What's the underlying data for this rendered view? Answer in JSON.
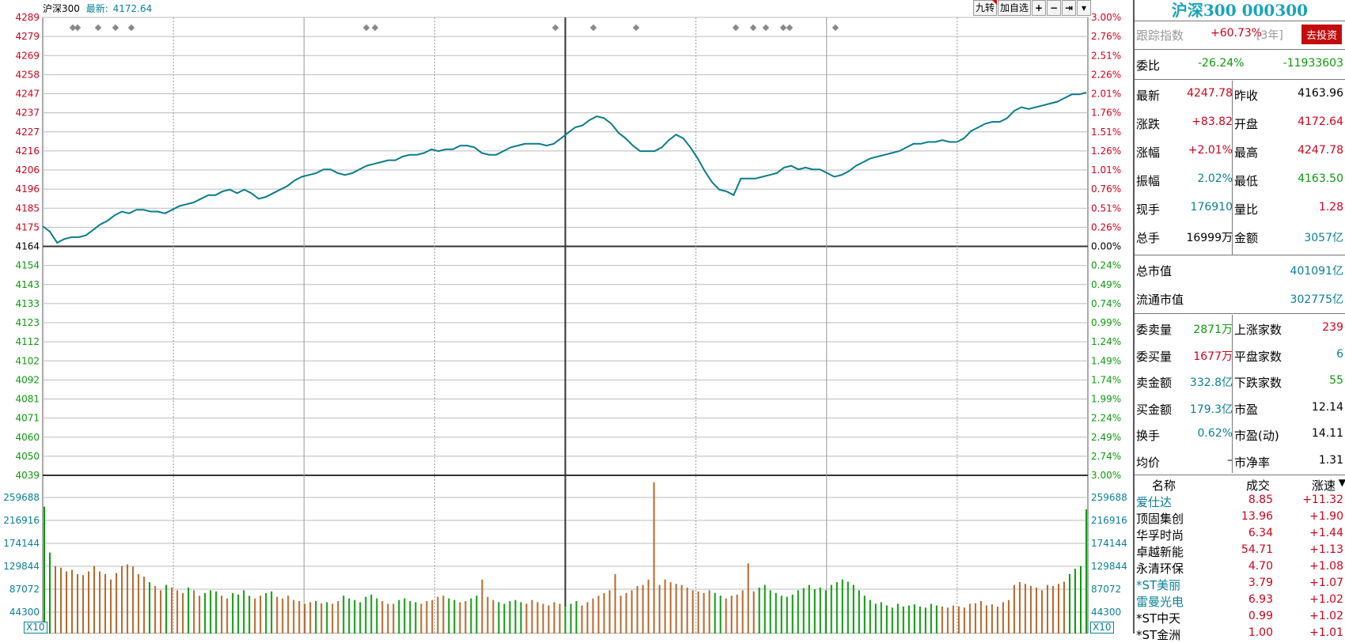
{
  "top_info": {
    "name": "沪深300",
    "latest_label": "最新:",
    "latest_value": "4172.64"
  },
  "toolbar": {
    "jiuzhuan": "九转",
    "add_fav": "加自选",
    "plus": "+",
    "minus": "−",
    "end": "⇥",
    "dropdown": "▾"
  },
  "price_axis": {
    "left": [
      "4289",
      "4279",
      "4269",
      "4258",
      "4247",
      "4237",
      "4227",
      "4216",
      "4206",
      "4196",
      "4185",
      "4175",
      "4164",
      "4154",
      "4143",
      "4133",
      "4123",
      "4112",
      "4102",
      "4092",
      "4081",
      "4071",
      "4060",
      "4050",
      "4039"
    ],
    "right": [
      "3.00%",
      "2.76%",
      "2.51%",
      "2.26%",
      "2.01%",
      "1.76%",
      "1.51%",
      "1.26%",
      "1.01%",
      "0.76%",
      "0.51%",
      "0.26%",
      "0.00%",
      "0.24%",
      "0.49%",
      "0.74%",
      "0.99%",
      "1.24%",
      "1.49%",
      "1.74%",
      "1.99%",
      "2.24%",
      "2.49%",
      "2.74%",
      "3.00%"
    ]
  },
  "volume_axis": {
    "labels": [
      "259688",
      "216916",
      "174144",
      "129844",
      "87072",
      "44300"
    ],
    "multiplier": "X10"
  },
  "chart_data": {
    "type": "line",
    "prev_close": 4163.96,
    "ylim": [
      4039,
      4289
    ],
    "price": [
      4175,
      4172,
      4166,
      4168,
      4169,
      4169,
      4170,
      4173,
      4176,
      4178,
      4181,
      4183,
      4182,
      4184,
      4184,
      4183,
      4183,
      4182,
      4184,
      4186,
      4187,
      4188,
      4190,
      4192,
      4192,
      4194,
      4195,
      4193,
      4195,
      4193,
      4190,
      4191,
      4193,
      4195,
      4197,
      4200,
      4202,
      4203,
      4204,
      4206,
      4206,
      4204,
      4203,
      4204,
      4206,
      4208,
      4209,
      4210,
      4211,
      4211,
      4213,
      4214,
      4214,
      4215,
      4217,
      4216,
      4217,
      4217,
      4219,
      4219,
      4218,
      4215,
      4214,
      4214,
      4216,
      4218,
      4219,
      4220,
      4220,
      4220,
      4219,
      4220,
      4223,
      4226,
      4229,
      4230,
      4233,
      4235,
      4234,
      4231,
      4226,
      4223,
      4219,
      4216,
      4216,
      4216,
      4218,
      4222,
      4225,
      4223,
      4218,
      4212,
      4205,
      4199,
      4195,
      4194,
      4192,
      4201,
      4201,
      4201,
      4202,
      4203,
      4204,
      4207,
      4208,
      4206,
      4207,
      4206,
      4206,
      4204,
      4202,
      4203,
      4205,
      4208,
      4210,
      4212,
      4213,
      4214,
      4215,
      4216,
      4218,
      4220,
      4220,
      4221,
      4221,
      4222,
      4221,
      4221,
      4223,
      4227,
      4229,
      4231,
      4232,
      4232,
      4234,
      4238,
      4240,
      4239,
      4240,
      4241,
      4242,
      4243,
      4245,
      4247,
      4247,
      4248
    ],
    "volume_markers": [
      235000,
      150000,
      125000,
      122000,
      115000,
      118000,
      110000,
      108000,
      115000,
      125000,
      115000,
      110000,
      100000,
      112000,
      125000,
      128000,
      124000,
      110000,
      105000,
      95000,
      88000,
      80000,
      90000,
      85000,
      80000,
      75000,
      85000,
      80000,
      70000,
      75000,
      80000,
      78000,
      70000,
      65000,
      75000,
      72000,
      80000,
      70000,
      65000,
      70000,
      75000,
      78000,
      68000,
      65000,
      70000,
      62000,
      60000,
      55000,
      58000,
      60000,
      56000,
      58000,
      55000,
      60000,
      70000,
      65000,
      62000,
      58000,
      68000,
      72000,
      65000,
      60000,
      55000,
      55000,
      62000,
      65000,
      60000,
      58000,
      55000,
      60000,
      62000,
      68000,
      70000,
      65000,
      62000,
      58000,
      60000,
      65000,
      70000,
      100000,
      68000,
      62000,
      58000,
      55000,
      60000,
      62000,
      58000,
      55000,
      62000,
      58000,
      55000,
      52000,
      58000,
      55000,
      50000,
      55000,
      60000,
      52000,
      58000,
      65000,
      70000,
      75000,
      80000,
      110000,
      70000,
      75000,
      80000,
      88000,
      90000,
      100000,
      280000,
      90000,
      100000,
      95000,
      92000,
      90000,
      85000,
      80000,
      78000,
      75000,
      80000,
      75000,
      70000,
      65000,
      70000,
      72000,
      80000,
      130000,
      78000,
      85000,
      90000,
      80000,
      75000,
      70000,
      68000,
      72000,
      80000,
      84000,
      90000,
      82000,
      85000,
      80000,
      90000,
      95000,
      100000,
      96000,
      90000,
      80000,
      70000,
      62000,
      55000,
      58000,
      52000,
      48000,
      55000,
      50000,
      52000,
      54000,
      50000,
      48000,
      55000,
      52000,
      50000,
      48000,
      52000,
      50000,
      48000,
      55000,
      56000,
      60000,
      52000,
      54000,
      50000,
      58000,
      62000,
      90000,
      95000,
      92000,
      88000,
      85000,
      80000,
      90000,
      88000,
      92000,
      96000,
      110000,
      120000,
      125000,
      230000
    ],
    "volume_colors": [
      "g",
      "g",
      "r",
      "r",
      "r",
      "r",
      "r",
      "r",
      "r",
      "r",
      "r",
      "r",
      "r",
      "r",
      "r",
      "r",
      "r",
      "r",
      "r",
      "g",
      "r",
      "r",
      "g",
      "r",
      "r",
      "r",
      "g",
      "r",
      "r",
      "g",
      "g",
      "g",
      "r",
      "r",
      "g",
      "g",
      "g",
      "g",
      "r",
      "r",
      "g",
      "g",
      "r",
      "r",
      "r",
      "r",
      "r",
      "r",
      "r",
      "g",
      "r",
      "g",
      "r",
      "r",
      "g",
      "g",
      "g",
      "g",
      "g",
      "g",
      "g",
      "r",
      "r",
      "r",
      "g",
      "g",
      "g",
      "g",
      "r",
      "r",
      "r",
      "r",
      "r",
      "g",
      "g",
      "r",
      "r",
      "g",
      "g",
      "r",
      "r",
      "r",
      "g",
      "g",
      "g",
      "g",
      "g",
      "r",
      "r",
      "r",
      "r",
      "r",
      "r",
      "r",
      "g",
      "g",
      "g",
      "r",
      "r",
      "r",
      "r",
      "r",
      "r",
      "r",
      "r",
      "r",
      "r",
      "r",
      "r",
      "r",
      "r",
      "r",
      "r",
      "r",
      "r",
      "r",
      "r",
      "r",
      "r",
      "r",
      "r",
      "g",
      "g",
      "r",
      "r",
      "r",
      "r",
      "r",
      "r",
      "g",
      "g",
      "g",
      "g",
      "g",
      "g",
      "g",
      "g",
      "g",
      "g",
      "g",
      "g",
      "g",
      "g",
      "g",
      "g",
      "g",
      "g",
      "g",
      "g",
      "g",
      "g",
      "g",
      "g",
      "g",
      "g",
      "g",
      "g",
      "g",
      "g",
      "g",
      "g",
      "g",
      "r",
      "r",
      "r",
      "r",
      "r",
      "r",
      "r",
      "r",
      "r",
      "r",
      "r",
      "r",
      "r",
      "r",
      "r",
      "r",
      "r",
      "r",
      "r",
      "r",
      "r",
      "r",
      "r",
      "g",
      "g",
      "g",
      "g",
      "r",
      "r",
      "r",
      "r",
      "r",
      "r",
      "r",
      "r",
      "r"
    ],
    "series": [
      {
        "values": []
      }
    ]
  },
  "panel": {
    "title": "沪深300 000300",
    "track_label": "跟踪指数",
    "track_value": "+60.73%",
    "track_period": "[3年]",
    "invest_btn": "去投资",
    "weibi_label": "委比",
    "weibi_pct": "-26.24%",
    "weibi_val": "-11933603",
    "rows": [
      {
        "l1": "最新",
        "v1": "4247.78",
        "c1": "red",
        "l2": "昨收",
        "v2": "4163.96",
        "c2": "black"
      },
      {
        "l1": "涨跌",
        "v1": "+83.82",
        "c1": "red",
        "l2": "开盘",
        "v2": "4172.64",
        "c2": "red"
      },
      {
        "l1": "涨幅",
        "v1": "+2.01%",
        "c1": "red",
        "l2": "最高",
        "v2": "4247.78",
        "c2": "red"
      },
      {
        "l1": "振幅",
        "v1": "2.02%",
        "c1": "teal",
        "l2": "最低",
        "v2": "4163.50",
        "c2": "green"
      },
      {
        "l1": "现手",
        "v1": "176910",
        "c1": "teal",
        "l2": "量比",
        "v2": "1.28",
        "c2": "red"
      },
      {
        "l1": "总手",
        "v1": "16999万",
        "c1": "black",
        "l2": "金额",
        "v2": "3057亿",
        "c2": "teal"
      }
    ],
    "mktcap_label": "总市值",
    "mktcap_value": "401091亿",
    "float_label": "流通市值",
    "float_value": "302775亿",
    "stats": [
      {
        "l1": "委卖量",
        "v1": "2871万",
        "c1": "green",
        "l2": "上涨家数",
        "v2": "239",
        "c2": "red"
      },
      {
        "l1": "委买量",
        "v1": "1677万",
        "c1": "red",
        "l2": "平盘家数",
        "v2": "6",
        "c2": "teal"
      },
      {
        "l1": "卖金额",
        "v1": "332.8亿",
        "c1": "teal",
        "l2": "下跌家数",
        "v2": "55",
        "c2": "green"
      },
      {
        "l1": "买金额",
        "v1": "179.3亿",
        "c1": "teal",
        "l2": "市盈",
        "v2": "12.14",
        "c2": "black"
      },
      {
        "l1": "换手",
        "v1": "0.62%",
        "c1": "teal",
        "l2": "市盈(动)",
        "v2": "14.11",
        "c2": "black"
      },
      {
        "l1": "均价",
        "v1": "–",
        "c1": "black",
        "l2": "市净率",
        "v2": "1.31",
        "c2": "black"
      }
    ],
    "list_headers": {
      "name": "名称",
      "price": "成交",
      "change": "涨速"
    },
    "list": [
      {
        "name": "爱仕达",
        "price": "8.85",
        "change": "+11.32",
        "nc": "teal"
      },
      {
        "name": "顶固集创",
        "price": "13.96",
        "change": "+1.90",
        "nc": "black"
      },
      {
        "name": "华孚时尚",
        "price": "6.34",
        "change": "+1.44",
        "nc": "black"
      },
      {
        "name": "卓越新能",
        "price": "54.71",
        "change": "+1.13",
        "nc": "black"
      },
      {
        "name": "永清环保",
        "price": "4.70",
        "change": "+1.08",
        "nc": "black"
      },
      {
        "name": "*ST美丽",
        "price": "3.79",
        "change": "+1.07",
        "nc": "teal"
      },
      {
        "name": "雷曼光电",
        "price": "6.93",
        "change": "+1.02",
        "nc": "teal"
      },
      {
        "name": "*ST中天",
        "price": "0.99",
        "change": "+1.02",
        "nc": "black"
      },
      {
        "name": "*ST金洲",
        "price": "1.00",
        "change": "+1.01",
        "nc": "black"
      }
    ]
  },
  "colors": {
    "line": "#0b7c8a",
    "up": "#d0021b",
    "down": "#0c9a0c",
    "volume_up": "#b8672a",
    "grid": "#888888",
    "accent": "#1aa3b8"
  }
}
